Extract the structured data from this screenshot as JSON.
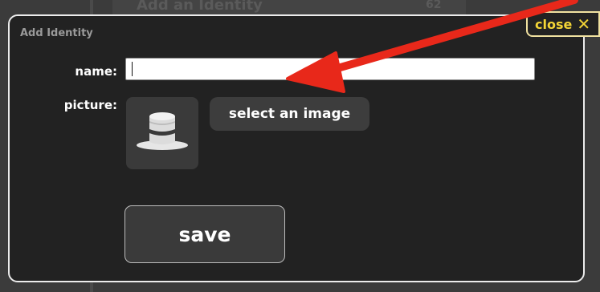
{
  "background": {
    "ghost_title": "Add an Identity",
    "ghost_count": "62"
  },
  "dialog": {
    "title": "Add Identity",
    "close_label": "close",
    "close_icon": "close-x-icon",
    "name_label": "name:",
    "name_value": "",
    "picture_label": "picture:",
    "picture_icon": "top-hat-icon",
    "select_image_label": "select an image",
    "save_label": "save"
  },
  "annotation": {
    "arrow_color": "#e8281a"
  },
  "colors": {
    "dialog_bg": "#222222",
    "dialog_border": "#ececec",
    "close_accent": "#f4d536"
  }
}
